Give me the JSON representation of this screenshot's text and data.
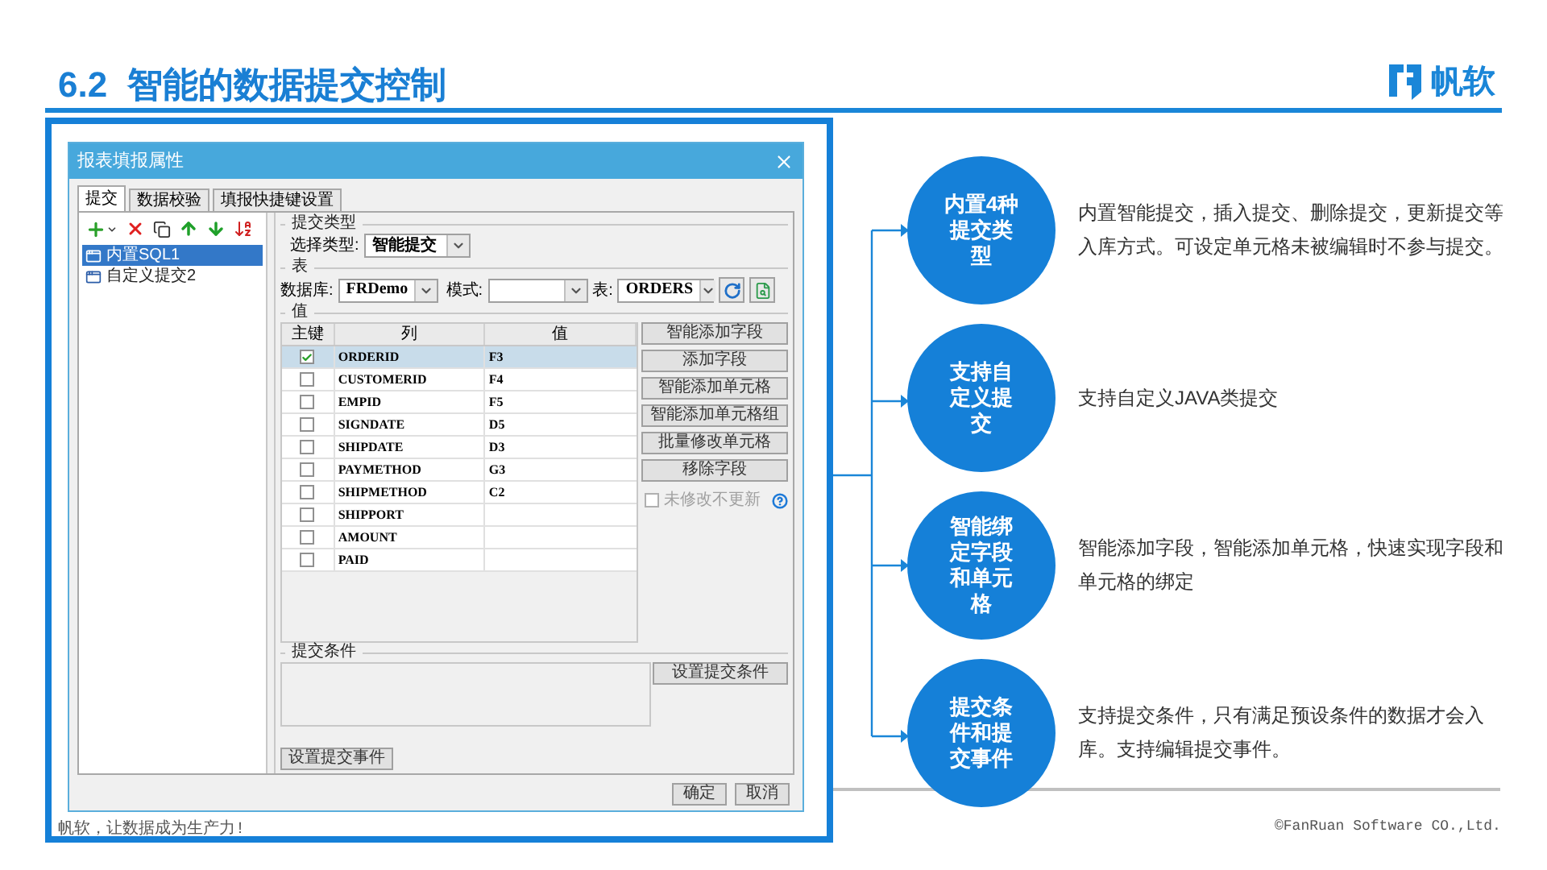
{
  "header": {
    "title": "6.2  智能的数据提交控制",
    "logo_text": "帆软"
  },
  "dialog": {
    "title": "报表填报属性",
    "tabs": [
      {
        "label": "提交",
        "selected": true
      },
      {
        "label": "数据校验",
        "selected": false
      },
      {
        "label": "填报快捷键设置",
        "selected": false
      }
    ],
    "submissions": [
      {
        "label": "内置SQL1",
        "selected": true
      },
      {
        "label": "自定义提交2",
        "selected": false
      }
    ],
    "submit_type": {
      "legend": "提交类型",
      "label": "选择类型:",
      "value": "智能提交"
    },
    "table_group": {
      "legend": "表",
      "database_label": "数据库:",
      "database": "FRDemo",
      "schema_label": "模式:",
      "table_label": "表:",
      "table": "ORDERS"
    },
    "values": {
      "legend": "值",
      "columns": [
        "主键",
        "列",
        "值"
      ],
      "rows": [
        {
          "key": true,
          "column": "ORDERID",
          "value": "F3",
          "selected": true
        },
        {
          "key": false,
          "column": "CUSTOMERID",
          "value": "F4",
          "selected": false
        },
        {
          "key": false,
          "column": "EMPID",
          "value": "F5",
          "selected": false
        },
        {
          "key": false,
          "column": "SIGNDATE",
          "value": "D5",
          "selected": false
        },
        {
          "key": false,
          "column": "SHIPDATE",
          "value": "D3",
          "selected": false
        },
        {
          "key": false,
          "column": "PAYMETHOD",
          "value": "G3",
          "selected": false
        },
        {
          "key": false,
          "column": "SHIPMETHOD",
          "value": "C2",
          "selected": false
        },
        {
          "key": false,
          "column": "SHIPPORT",
          "selected": false
        },
        {
          "key": false,
          "column": "AMOUNT",
          "selected": false
        },
        {
          "key": false,
          "column": "PAID",
          "selected": false
        }
      ],
      "buttons": [
        "智能添加字段",
        "添加字段",
        "智能添加单元格",
        "智能添加单元格组",
        "批量修改单元格",
        "移除字段"
      ],
      "no_update_unmodified": {
        "label": "未修改不更新",
        "checked": false,
        "disabled": true
      }
    },
    "condition": {
      "legend": "提交条件",
      "button": "设置提交条件"
    },
    "event_button": "设置提交事件",
    "footer_buttons": [
      "确定",
      "取消"
    ]
  },
  "features": [
    {
      "title": "内置4种提交类型",
      "description": "内置智能提交，插入提交、删除提交，更新提交等入库方式。可设定单元格未被编辑时不参与提交。"
    },
    {
      "title": "支持自定义提交",
      "description": "支持自定义JAVA类提交"
    },
    {
      "title": "智能绑定字段和单元格",
      "description": "智能添加字段，智能添加单元格，快速实现字段和单元格的绑定"
    },
    {
      "title": "提交条件和提交事件",
      "description": "支持提交条件，只有满足预设条件的数据才会入库。支持编辑提交事件。"
    }
  ],
  "footer": {
    "slogan": "帆软，让数据成为生产力!",
    "copyright": "©FanRuan Software CO.,Ltd."
  }
}
